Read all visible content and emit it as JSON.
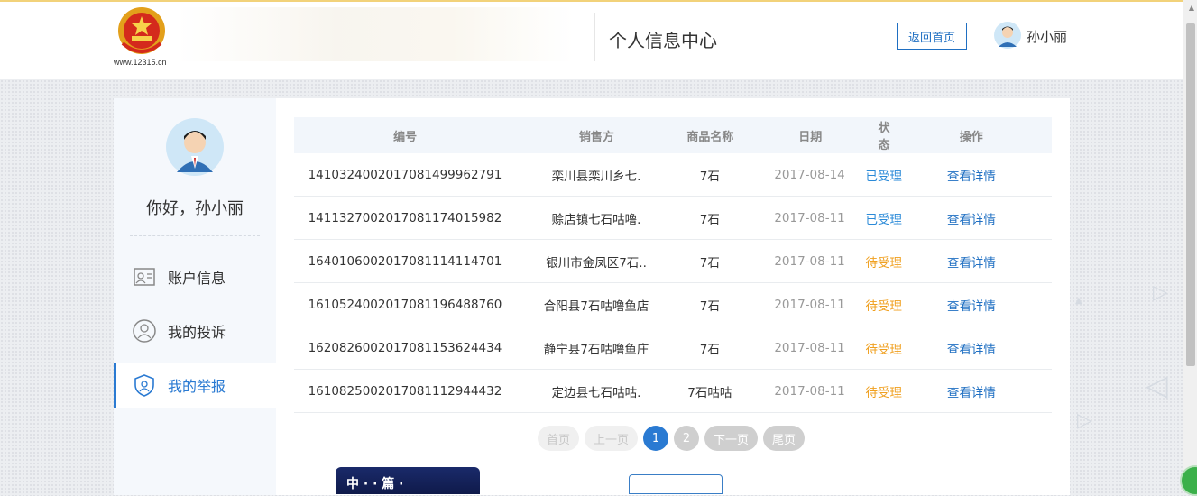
{
  "header": {
    "logo_url": "www.12315.cn",
    "page_title": "个人信息中心",
    "home_button": "返回首页",
    "user_name": "孙小丽"
  },
  "sidebar": {
    "greeting": "你好，孙小丽",
    "items": [
      {
        "label": "账户信息",
        "icon": "account-card-icon",
        "active": false
      },
      {
        "label": "我的投诉",
        "icon": "complaint-person-icon",
        "active": false
      },
      {
        "label": "我的举报",
        "icon": "report-shield-icon",
        "active": true
      }
    ]
  },
  "table": {
    "columns": [
      "编号",
      "销售方",
      "商品名称",
      "日期",
      "状态",
      "操作"
    ],
    "rows": [
      {
        "id": "141032400201708149996279​1",
        "seller": "栾川县栾川乡七.",
        "product": "7石",
        "date": "2017-08-14",
        "status": "已受理",
        "status_type": "ok",
        "action": "查看详情"
      },
      {
        "id": "141132700201708117401598​2",
        "seller": "赊店镇七石咕噜.",
        "product": "7石",
        "date": "2017-08-11",
        "status": "已受理",
        "status_type": "ok",
        "action": "查看详情"
      },
      {
        "id": "164010600201708111411470​1",
        "seller": "银川市金凤区7石..",
        "product": "7石",
        "date": "2017-08-11",
        "status": "待受理",
        "status_type": "wait",
        "action": "查看详情"
      },
      {
        "id": "161052400201708119648876​0",
        "seller": "合阳县7石咕噜鱼店",
        "product": "7石",
        "date": "2017-08-11",
        "status": "待受理",
        "status_type": "wait",
        "action": "查看详情"
      },
      {
        "id": "162082600201708115362443​4",
        "seller": "静宁县7石咕噜鱼庄",
        "product": "7石",
        "date": "2017-08-11",
        "status": "待受理",
        "status_type": "wait",
        "action": "查看详情"
      },
      {
        "id": "161082500201708111294443​2",
        "seller": "定边县七石咕咕.",
        "product": "7石咕咕",
        "date": "2017-08-11",
        "status": "待受理",
        "status_type": "wait",
        "action": "查看详情"
      }
    ]
  },
  "pager": {
    "first": "首页",
    "prev": "上一页",
    "pages": [
      "1",
      "2"
    ],
    "current": "1",
    "next": "下一页",
    "last": "尾页"
  },
  "footer": {
    "banner_text": "中 · · 篇 ·"
  },
  "colors": {
    "accent": "#2a7ad2",
    "status_ok": "#2a8ad8",
    "status_wait": "#f0a020"
  }
}
